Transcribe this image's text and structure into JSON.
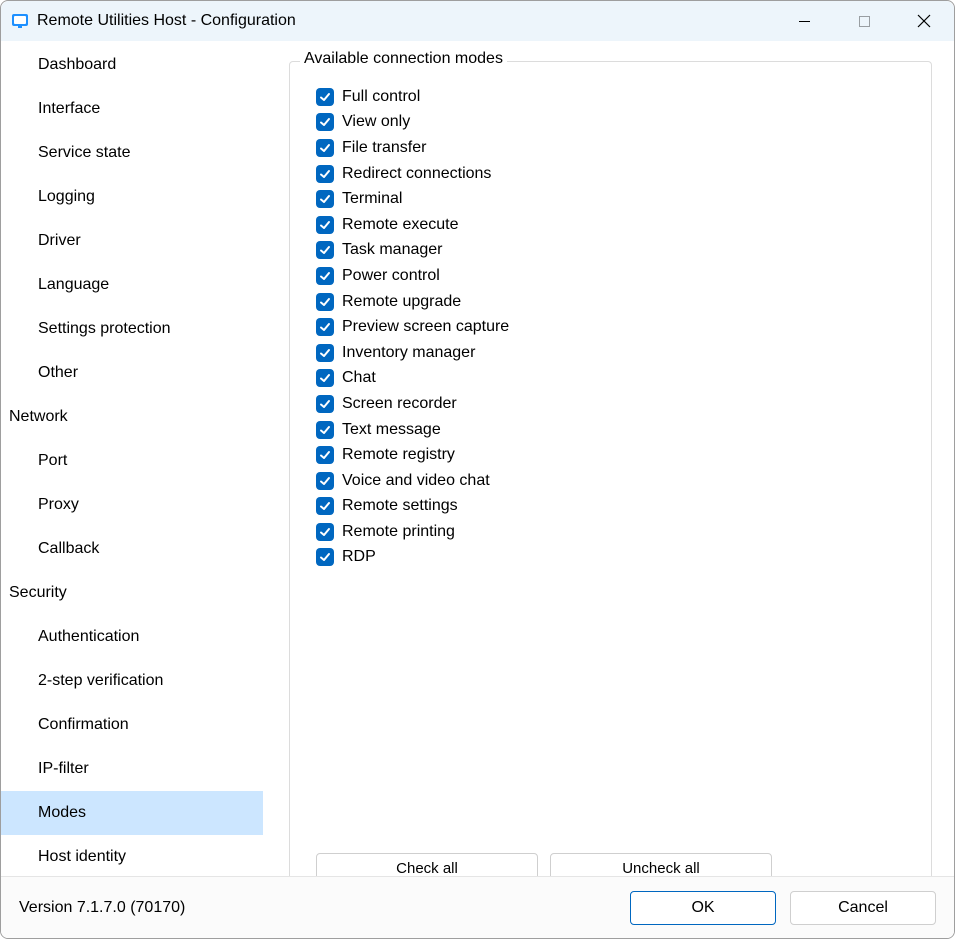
{
  "window": {
    "title": "Remote Utilities Host - Configuration"
  },
  "sidebar": {
    "items": [
      {
        "label": "Dashboard",
        "level": 2,
        "selected": false
      },
      {
        "label": "Interface",
        "level": 2,
        "selected": false
      },
      {
        "label": "Service state",
        "level": 2,
        "selected": false
      },
      {
        "label": "Logging",
        "level": 2,
        "selected": false
      },
      {
        "label": "Driver",
        "level": 2,
        "selected": false
      },
      {
        "label": "Language",
        "level": 2,
        "selected": false
      },
      {
        "label": "Settings protection",
        "level": 2,
        "selected": false
      },
      {
        "label": "Other",
        "level": 2,
        "selected": false
      },
      {
        "label": "Network",
        "level": 1,
        "selected": false
      },
      {
        "label": "Port",
        "level": 2,
        "selected": false
      },
      {
        "label": "Proxy",
        "level": 2,
        "selected": false
      },
      {
        "label": "Callback",
        "level": 2,
        "selected": false
      },
      {
        "label": "Security",
        "level": 1,
        "selected": false
      },
      {
        "label": "Authentication",
        "level": 2,
        "selected": false
      },
      {
        "label": "2-step verification",
        "level": 2,
        "selected": false
      },
      {
        "label": "Confirmation",
        "level": 2,
        "selected": false
      },
      {
        "label": "IP-filter",
        "level": 2,
        "selected": false
      },
      {
        "label": "Modes",
        "level": 2,
        "selected": true
      },
      {
        "label": "Host identity",
        "level": 2,
        "selected": false
      }
    ]
  },
  "main": {
    "group_title": "Available connection modes",
    "modes": [
      {
        "label": "Full control",
        "checked": true
      },
      {
        "label": "View only",
        "checked": true
      },
      {
        "label": "File transfer",
        "checked": true
      },
      {
        "label": "Redirect connections",
        "checked": true
      },
      {
        "label": "Terminal",
        "checked": true
      },
      {
        "label": "Remote execute",
        "checked": true
      },
      {
        "label": "Task manager",
        "checked": true
      },
      {
        "label": "Power control",
        "checked": true
      },
      {
        "label": "Remote upgrade",
        "checked": true
      },
      {
        "label": "Preview screen capture",
        "checked": true
      },
      {
        "label": "Inventory manager",
        "checked": true
      },
      {
        "label": "Chat",
        "checked": true
      },
      {
        "label": "Screen recorder",
        "checked": true
      },
      {
        "label": "Text message",
        "checked": true
      },
      {
        "label": "Remote registry",
        "checked": true
      },
      {
        "label": "Voice and video chat",
        "checked": true
      },
      {
        "label": "Remote settings",
        "checked": true
      },
      {
        "label": "Remote printing",
        "checked": true
      },
      {
        "label": "RDP",
        "checked": true
      }
    ],
    "buttons": {
      "check_all": "Check all",
      "uncheck_all": "Uncheck all"
    }
  },
  "footer": {
    "version": "Version 7.1.7.0 (70170)",
    "ok": "OK",
    "cancel": "Cancel"
  }
}
